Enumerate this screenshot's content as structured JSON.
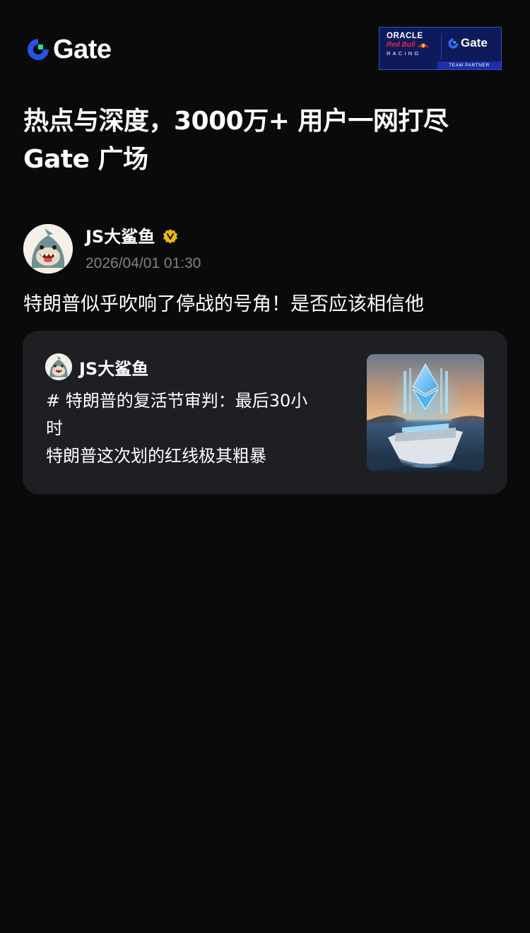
{
  "brand": {
    "logo_text": "Gate",
    "partner_badge": {
      "line1": "ORACLE",
      "line2": "Red Bull",
      "line3": "RACING",
      "gate_text": "Gate",
      "footer": "TEAM PARTNER"
    }
  },
  "headline": {
    "line1": "热点与深度，3000万+ 用户一网打尽",
    "line2": "Gate 广场"
  },
  "post": {
    "author": "JS大鲨鱼",
    "verified": true,
    "time": "2026/04/01 01:30",
    "text": "特朗普似乎吹响了停战的号角！是否应该相信他"
  },
  "quoted": {
    "author": "JS大鲨鱼",
    "line1": "# 特朗普的复活节审判：最后30小",
    "line2": "时",
    "line3": "特朗普这次划的红线极其粗暴",
    "thumbnail_icon": "ethereum-yacht-image"
  },
  "colors": {
    "background": "#0a0a0b",
    "card": "#1e1f23",
    "brand_blue": "#2354e6",
    "brand_green": "#17e6a1",
    "verified_gold": "#f0b90b",
    "muted_text": "#7f8087"
  }
}
